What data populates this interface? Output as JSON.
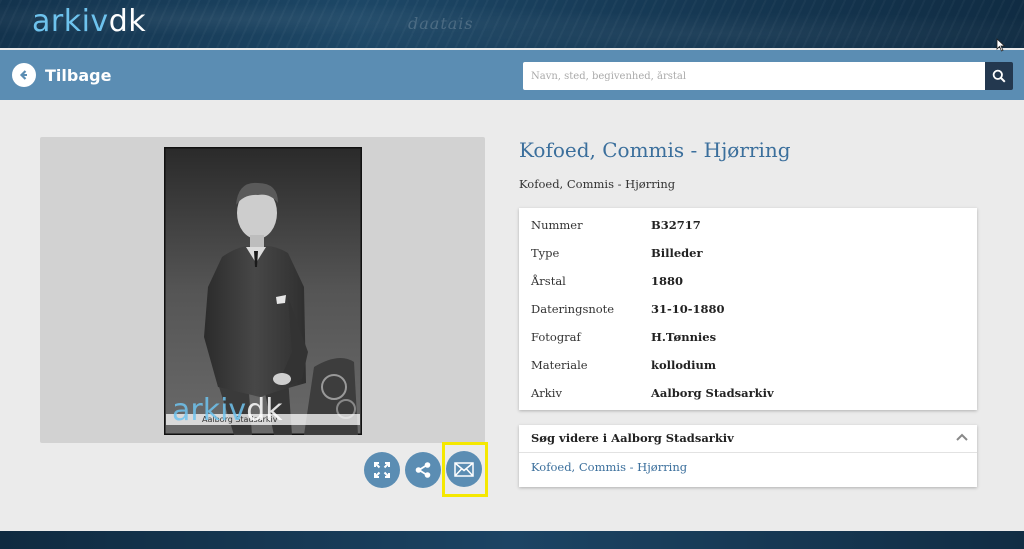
{
  "header": {
    "logo_part1": "arkiv",
    "logo_part2": "dk",
    "banner_script": "daatais"
  },
  "nav": {
    "back_label": "Tilbage",
    "search_placeholder": "Navn, sted, begivenhed, årstal",
    "search_icon": "search-icon",
    "back_icon": "arrow-left-circle-icon"
  },
  "image": {
    "watermark_part1": "arkiv",
    "watermark_part2": "dk",
    "watermark_caption": "Aalborg Stadsarkiv"
  },
  "actions": {
    "fullscreen_icon": "expand-icon",
    "share_icon": "share-icon",
    "email_icon": "envelope-icon"
  },
  "record": {
    "title": "Kofoed, Commis - Hjørring",
    "subtitle": "Kofoed, Commis - Hjørring",
    "fields": [
      {
        "label": "Nummer",
        "value": "B32717"
      },
      {
        "label": "Type",
        "value": "Billeder"
      },
      {
        "label": "Årstal",
        "value": "1880"
      },
      {
        "label": "Dateringsnote",
        "value": "31-10-1880"
      },
      {
        "label": "Fotograf",
        "value": "H.Tønnies"
      },
      {
        "label": "Materiale",
        "value": "kollodium"
      },
      {
        "label": "Arkiv",
        "value": "Aalborg Stadsarkiv"
      }
    ]
  },
  "search_more": {
    "heading": "Søg videre i Aalborg Stadsarkiv",
    "link": "Kofoed, Commis - Hjørring"
  },
  "colors": {
    "accent": "#5b8db3",
    "title": "#3b6f9c",
    "highlight": "#f5e800",
    "banner": "#1d4766"
  }
}
